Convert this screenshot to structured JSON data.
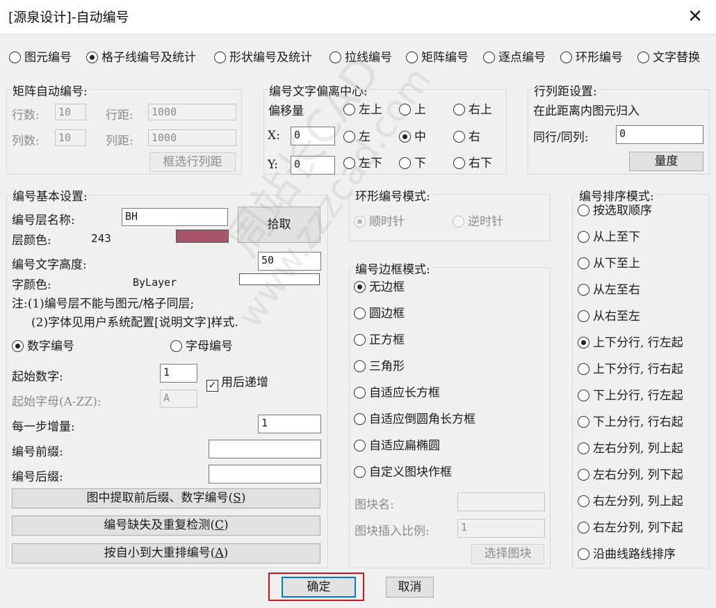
{
  "window": {
    "title": "[源泉设计]-自动编号",
    "close_glyph": "✕"
  },
  "mode_tabs": [
    {
      "label": "图元编号",
      "checked": false
    },
    {
      "label": "格子线编号及统计",
      "checked": true
    },
    {
      "label": "形状编号及统计",
      "checked": false
    },
    {
      "label": "拉线编号",
      "checked": false
    },
    {
      "label": "矩阵编号",
      "checked": false
    },
    {
      "label": "逐点编号",
      "checked": false
    },
    {
      "label": "环形编号",
      "checked": false
    },
    {
      "label": "文字替换",
      "checked": false
    }
  ],
  "matrix": {
    "title": "矩阵自动编号:",
    "rows_label": "行数:",
    "rows_value": "10",
    "row_dist_label": "行距:",
    "row_dist_value": "1000",
    "cols_label": "列数:",
    "cols_value": "10",
    "col_dist_label": "列距:",
    "col_dist_value": "1000",
    "select_button": "框选行列距"
  },
  "offset": {
    "title": "编号文字偏离中心:",
    "amount_label": "偏移量",
    "x_label": "X:",
    "x_value": "0",
    "y_label": "Y:",
    "y_value": "0",
    "positions": [
      {
        "label": "左上",
        "checked": false
      },
      {
        "label": "上",
        "checked": false
      },
      {
        "label": "右上",
        "checked": false
      },
      {
        "label": "左",
        "checked": false
      },
      {
        "label": "中",
        "checked": true
      },
      {
        "label": "右",
        "checked": false
      },
      {
        "label": "左下",
        "checked": false
      },
      {
        "label": "下",
        "checked": false
      },
      {
        "label": "右下",
        "checked": false
      }
    ]
  },
  "spacing": {
    "title": "行列距设置:",
    "desc": "在此距离内图元归入",
    "same_label": "同行/同列:",
    "same_value": "0",
    "measure_button": "量度"
  },
  "basic": {
    "title": "编号基本设置:",
    "layer_name_label": "编号层名称:",
    "layer_name_value": "BH",
    "pick_button": "拾取",
    "layer_color_label": "层颜色:",
    "layer_color_value": "243",
    "layer_color_hex": "#a9546a",
    "text_height_label": "编号文字高度:",
    "text_height_value": "50",
    "font_color_label": "字颜色:",
    "font_color_value": "ByLayer",
    "note1": "注:(1)编号层不能与图元/格子同层;",
    "note2": "(2)字体见用户系统配置[说明文字]样式.",
    "numeric_label": "数字编号",
    "numeric_checked": true,
    "alpha_label": "字母编号",
    "alpha_checked": false,
    "start_num_label": "起始数字:",
    "start_num_value": "1",
    "increment_after_label": "用后递增",
    "increment_after_checked": true,
    "start_letter_label": "起始字母(A-ZZ):",
    "start_letter_value": "A",
    "step_label": "每一步增量:",
    "step_value": "1",
    "prefix_label": "编号前缀:",
    "prefix_value": "",
    "suffix_label": "编号后缀:",
    "suffix_value": "",
    "extract_button_text": "图中提取前后缀、数字编号(",
    "extract_button_key": "S",
    "extract_button_end": ")",
    "check_button_text": "编号缺失及重复检测(",
    "check_button_key": "C",
    "check_button_end": ")",
    "renumber_button_text": "按自小到大重排编号(",
    "renumber_button_key": "A",
    "renumber_button_end": ")"
  },
  "ring": {
    "title": "环形编号模式:",
    "cw_label": "顺时针",
    "cw_checked": true,
    "ccw_label": "逆时针",
    "ccw_checked": false
  },
  "border": {
    "title": "编号边框模式:",
    "options": [
      {
        "label": "无边框",
        "checked": true
      },
      {
        "label": "圆边框",
        "checked": false
      },
      {
        "label": "正方框",
        "checked": false
      },
      {
        "label": "三角形",
        "checked": false
      },
      {
        "label": "自适应长方框",
        "checked": false
      },
      {
        "label": "自适应倒圆角长方框",
        "checked": false
      },
      {
        "label": "自适应扁椭圆",
        "checked": false
      },
      {
        "label": "自定义图块作框",
        "checked": false
      }
    ],
    "block_name_label": "图块名:",
    "block_name_value": "",
    "block_scale_label": "图块插入比例:",
    "block_scale_value": "1",
    "select_block_button": "选择图块"
  },
  "sort": {
    "title": "编号排序模式:",
    "options": [
      {
        "label": "按选取顺序",
        "checked": false
      },
      {
        "label": "从上至下",
        "checked": false
      },
      {
        "label": "从下至上",
        "checked": false
      },
      {
        "label": "从左至右",
        "checked": false
      },
      {
        "label": "从右至左",
        "checked": false
      },
      {
        "label": "上下分行, 行左起",
        "checked": true
      },
      {
        "label": "上下分行, 行右起",
        "checked": false
      },
      {
        "label": "下上分行, 行左起",
        "checked": false
      },
      {
        "label": "下上分行, 行右起",
        "checked": false
      },
      {
        "label": "左右分列, 列上起",
        "checked": false
      },
      {
        "label": "左右分列, 列下起",
        "checked": false
      },
      {
        "label": "右左分列, 列上起",
        "checked": false
      },
      {
        "label": "右左分列, 列下起",
        "checked": false
      },
      {
        "label": "沿曲线路线排序",
        "checked": false
      }
    ]
  },
  "footer": {
    "ok_label": "确定",
    "cancel_label": "取消",
    "highlight_color": "#d0151e"
  },
  "watermark": {
    "text1": "周站长CAD",
    "text2": "www.zzzcad.com"
  }
}
